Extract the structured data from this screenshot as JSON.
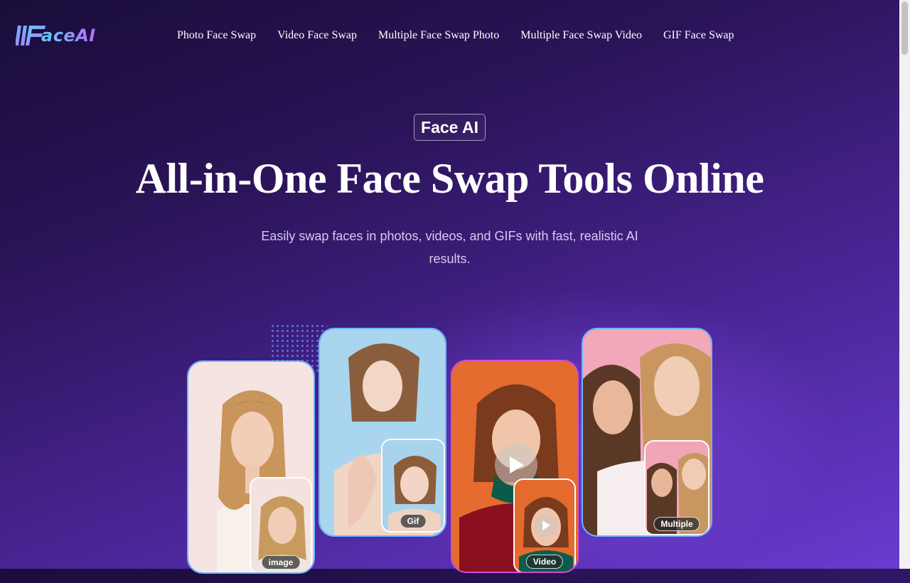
{
  "header": {
    "logo_text": "aceAI",
    "nav": [
      {
        "label": "Photo Face Swap"
      },
      {
        "label": "Video Face Swap"
      },
      {
        "label": "Multiple Face Swap Photo"
      },
      {
        "label": "Multiple Face Swap Video"
      },
      {
        "label": "GIF Face Swap"
      }
    ]
  },
  "hero": {
    "badge": "Face AI",
    "title": "All-in-One Face Swap Tools Online",
    "subtitle": "Easily swap faces in photos, videos, and GIFs with fast, realistic AI results."
  },
  "cards": [
    {
      "tag": "image"
    },
    {
      "tag": "Gif"
    },
    {
      "tag": "Video"
    },
    {
      "tag": "Multiple"
    }
  ],
  "colors": {
    "accent_blue": "#6fb5ff",
    "accent_pink": "#d64bd9",
    "bg_dark": "#1a0d3a",
    "bg_light": "#6a3bd0"
  },
  "icons": [
    "faceai-logo-icon",
    "play-icon"
  ]
}
